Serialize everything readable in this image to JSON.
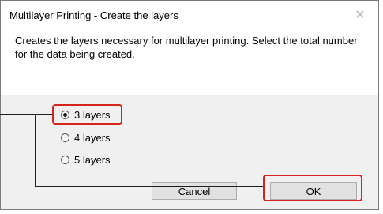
{
  "dialog": {
    "title": "Multilayer Printing - Create the layers",
    "close_glyph": "✕",
    "message": "Creates the layers necessary for multilayer printing. Select the total number for the data being created."
  },
  "layer_options": [
    {
      "label": "3 layers",
      "checked": true
    },
    {
      "label": "4 layers",
      "checked": false
    },
    {
      "label": "5 layers",
      "checked": false
    }
  ],
  "buttons": {
    "cancel_label": "Cancel",
    "ok_label": "OK"
  },
  "colors": {
    "highlight": "#d4241c",
    "callout_line": "#1e1e1e"
  }
}
